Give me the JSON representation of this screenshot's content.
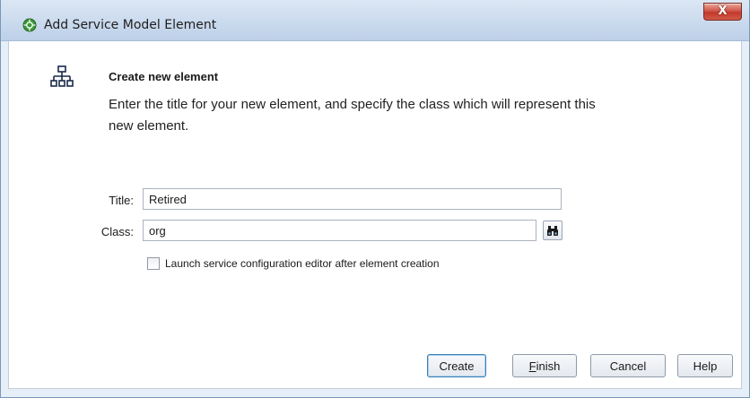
{
  "window": {
    "title": "Add Service Model Element",
    "close_glyph": "X"
  },
  "header": {
    "heading": "Create new element",
    "description": "Enter the title for your new element, and specify the class which will represent this new element.",
    "icon": "hierarchy-tree-icon"
  },
  "form": {
    "title_label": "Title:",
    "title_value": "Retired",
    "class_label": "Class:",
    "class_value": "org",
    "search_icon": "binoculars-icon",
    "launch_editor_label": "Launch service configuration editor after element creation",
    "launch_editor_checked": false
  },
  "buttons": {
    "create": "Create",
    "finish_mnemonic": "F",
    "finish_rest": "inish",
    "cancel": "Cancel",
    "help": "Help"
  },
  "colors": {
    "window_frame": "#e6eef7",
    "close_button": "#c94a3c",
    "default_button_border": "#3c7fb1"
  }
}
